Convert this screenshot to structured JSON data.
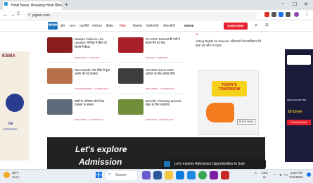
{
  "browser": {
    "tab_title": "Hindi News, Breaking Hindi New",
    "tab_close": "×",
    "new_tab": "+",
    "url": "jagran.com",
    "nav_back": "←",
    "nav_forward": "→",
    "nav_reload": "C",
    "win_min": "−",
    "win_max": "☐",
    "win_close": "✕"
  },
  "site": {
    "logo_text": "जागरण",
    "nav": [
      "होम",
      "राज्य",
      "राजनीति",
      "मनोरंजन",
      "क्रिकेट",
      "शिक्षा",
      "बिजनेस",
      "टेक्नोलॉजी",
      "जीवनशैली"
    ],
    "nav_active": "शिक्षा",
    "more": "MORE",
    "subscribe": "SUBSCRIBE",
    "small_tag": "मेरी"
  },
  "left_news": [
    {
      "title": "Manipur Violence Live Updates: मणिपुर में हिंसा पर दिल्ली में बैठक",
      "meta": "EDUCATION · 1 MIN AGO"
    },
    {
      "title": "Ram Mandir: राम मंदिर में पूजा अर्चना की नई व्यवस्था",
      "meta": "UTTAR PRADESH · 2 HOURS AGO"
    },
    {
      "title": "छात्रों के अधिकार और शिक्षा व्यवस्था पर सवाल",
      "meta": "EDUCATION · 2 HOURS AGO"
    }
  ],
  "mid_news": [
    {
      "title": "IPL 2023: Russell की पारी ने बदला मैच का रुख",
      "meta": "CRICKET · 1 MIN AGO"
    },
    {
      "title": "UKSSSC Exam 2023: आवेदन के लिए अंतिम तिथि",
      "meta": "EDUCATION · 2 HOURS AGO"
    },
    {
      "title": "Benefits of Moving Sprouts: सेहत के लिए फायदेमंद",
      "meta": "LIFESTYLE · 2 HOURS AGO"
    }
  ],
  "right_news": "Voting Rights for Women: महिलाओं को मताधिकार देने वाला देश कौन था पहला",
  "ad_left": {
    "brand": "KISNA",
    "line1": "IGI",
    "line2": "CERTIFIED"
  },
  "ad_mid": {
    "headline": "TODAY'S TOMORROW",
    "cta": "BOOK NOW"
  },
  "ad_right": {
    "title": "Now you can find",
    "num": "10 Crore",
    "cta": "Check Premium"
  },
  "admission": {
    "line1": "Let's explore",
    "line2": "Admission"
  },
  "toast": "Let's explore Admission Opportunities in Scie",
  "taskbar": {
    "weather_temp": "36°F",
    "weather_desc": "Hazy",
    "search": "Search",
    "lang": "ENG",
    "region": "IN",
    "time": "2:24 PM",
    "date": "7/11/2023"
  },
  "colors": {
    "accent": "#d71920",
    "brand": "#1c75bc"
  }
}
